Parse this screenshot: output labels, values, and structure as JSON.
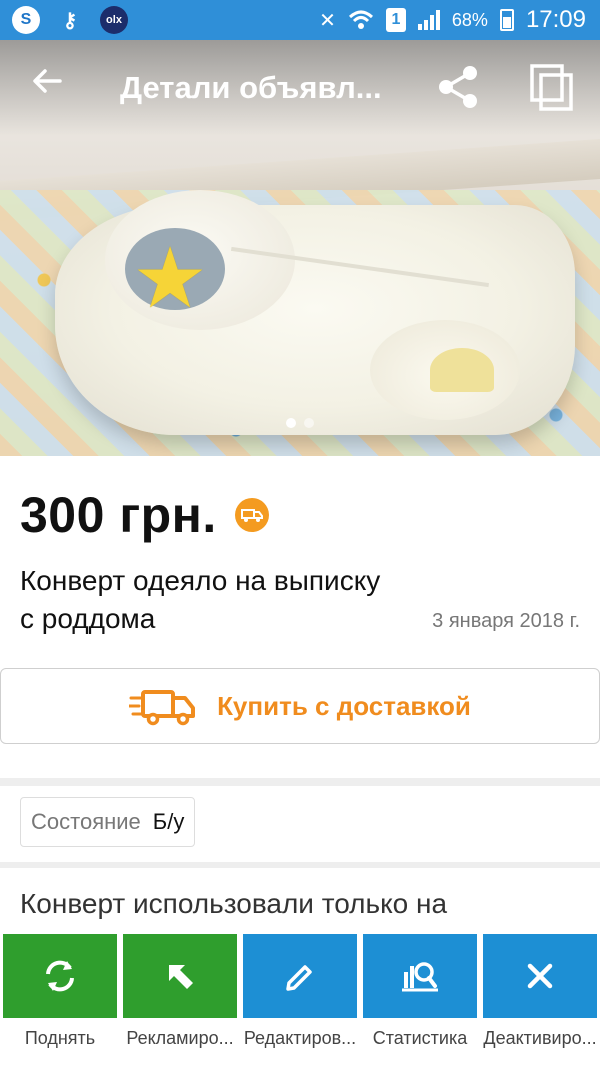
{
  "status_bar": {
    "left_apps": [
      "S",
      "key-icon",
      "olx-icon"
    ],
    "battery": "68%",
    "sim": "1",
    "time": "17:09"
  },
  "toolbar": {
    "title": "Детали объявл...",
    "back_icon": "arrow-left-icon",
    "share_icon": "share-icon",
    "copy_icon": "copy-icon"
  },
  "hero": {
    "image_count": 2,
    "active_index": 0
  },
  "listing": {
    "price": "300 грн.",
    "title": "Конверт одеяло на выписку с роддома",
    "date": "3 января 2018 г.",
    "delivery_badge_icon": "delivery-truck-icon"
  },
  "buy": {
    "label": "Купить с доставкой"
  },
  "condition": {
    "key": "Состояние",
    "value": "Б/у"
  },
  "description": {
    "text": "Конверт использовали только на"
  },
  "actions": [
    {
      "label": "Поднять",
      "icon": "refresh-icon",
      "color": "#2f9e2d"
    },
    {
      "label": "Рекламиро...",
      "icon": "arrow-up-left-icon",
      "color": "#2f9e2d"
    },
    {
      "label": "Редактиров...",
      "icon": "pencil-icon",
      "color": "#1d8fd4"
    },
    {
      "label": "Статистика",
      "icon": "statistics-icon",
      "color": "#1d8fd4"
    },
    {
      "label": "Деактивиро...",
      "icon": "close-icon",
      "color": "#1d8fd4"
    }
  ],
  "colors": {
    "status_bar": "#2f8fd8",
    "accent_orange": "#f08c1e",
    "green": "#2f9e2d",
    "blue": "#1d8fd4"
  }
}
